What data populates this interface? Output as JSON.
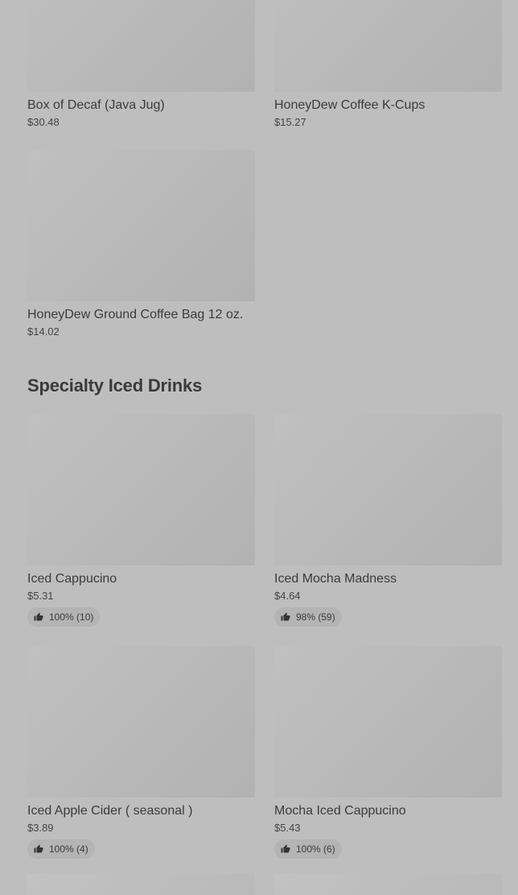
{
  "top_products": [
    {
      "name": "Box of Decaf (Java Jug)",
      "price": "$30.48"
    },
    {
      "name": "HoneyDew Coffee K-Cups",
      "price": "$15.27"
    },
    {
      "name": "HoneyDew Ground Coffee Bag 12 oz.",
      "price": "$14.02"
    }
  ],
  "section": {
    "title": "Specialty Iced Drinks"
  },
  "iced_products": [
    {
      "name": "Iced Cappucino",
      "price": "$5.31",
      "rating": "100% (10)"
    },
    {
      "name": "Iced Mocha Madness",
      "price": "$4.64",
      "rating": "98% (59)"
    },
    {
      "name": "Iced Apple Cider ( seasonal )",
      "price": "$3.89",
      "rating": "100% (4)"
    },
    {
      "name": "Mocha Iced Cappucino",
      "price": "$5.43",
      "rating": "100% (6)"
    }
  ],
  "icons": {
    "rating": "thumbs-up-icon"
  }
}
